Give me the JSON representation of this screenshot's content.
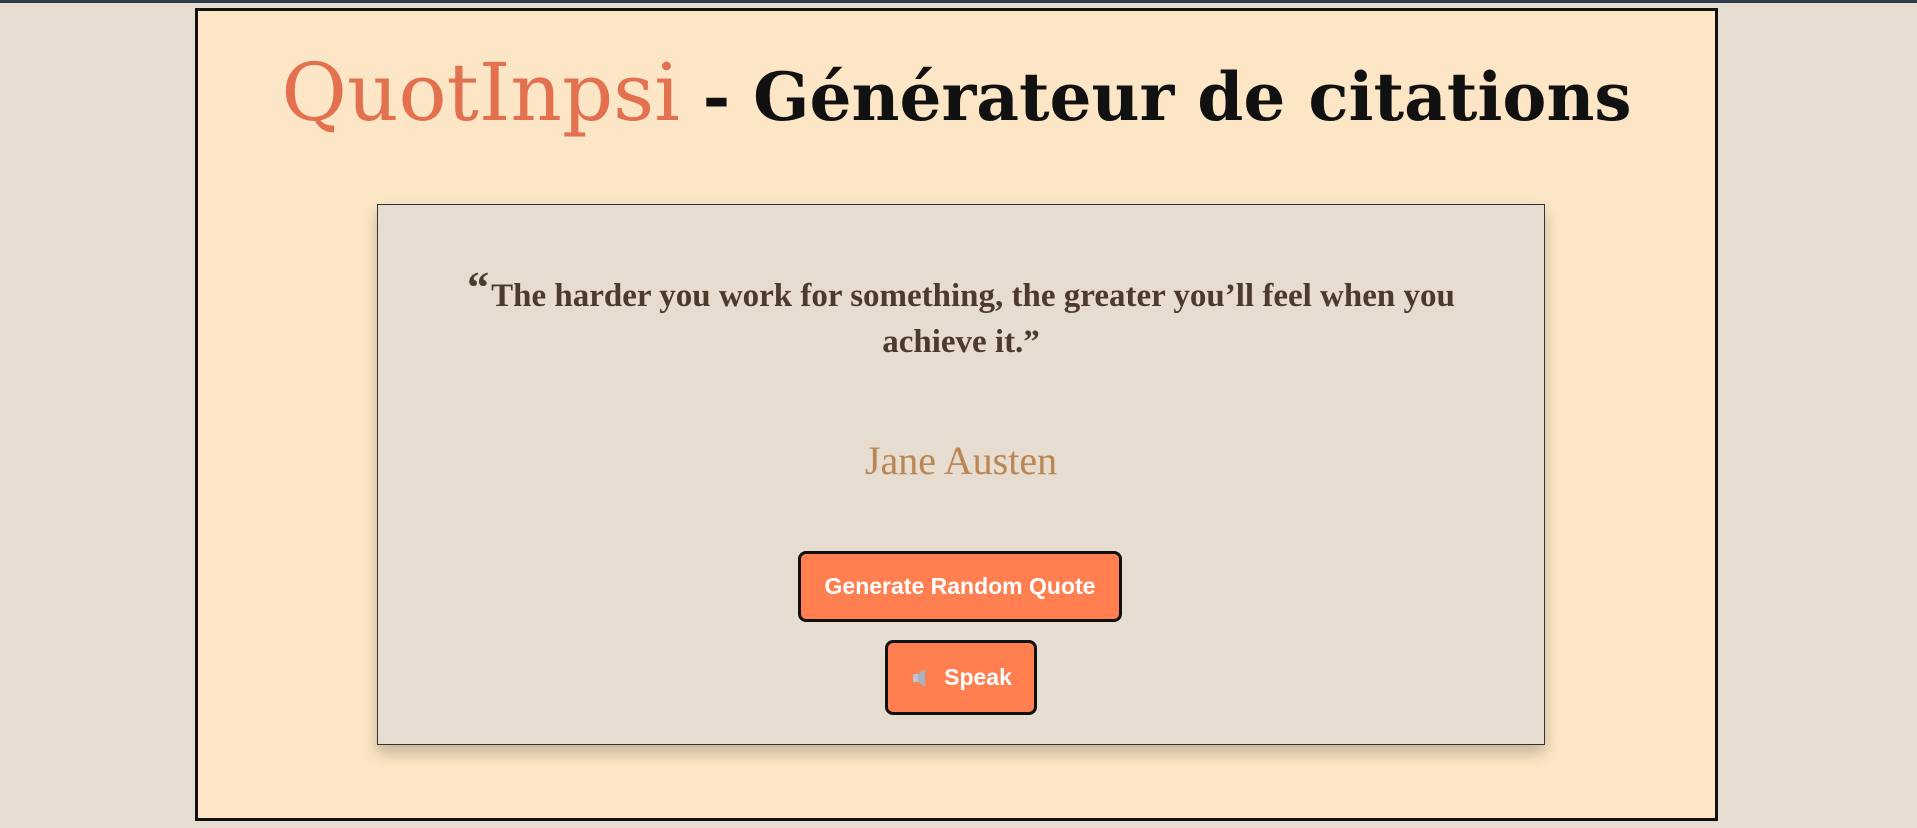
{
  "header": {
    "brand": "QuotInpsi",
    "subtitle": "- Générateur de citations"
  },
  "quote": {
    "open_mark": "“",
    "text": "The harder you work for something, the greater you’ll feel when you achieve it.”"
  },
  "author": "Jane Austen",
  "buttons": {
    "generate_label": "Generate Random Quote",
    "speak_label": "Speak",
    "speak_icon": "speaker-icon"
  },
  "colors": {
    "page_bg": "#e6dccf",
    "frame_bg": "#fce6c5",
    "brand": "#e3704f",
    "author": "#b98654",
    "button": "#ff7f50"
  }
}
